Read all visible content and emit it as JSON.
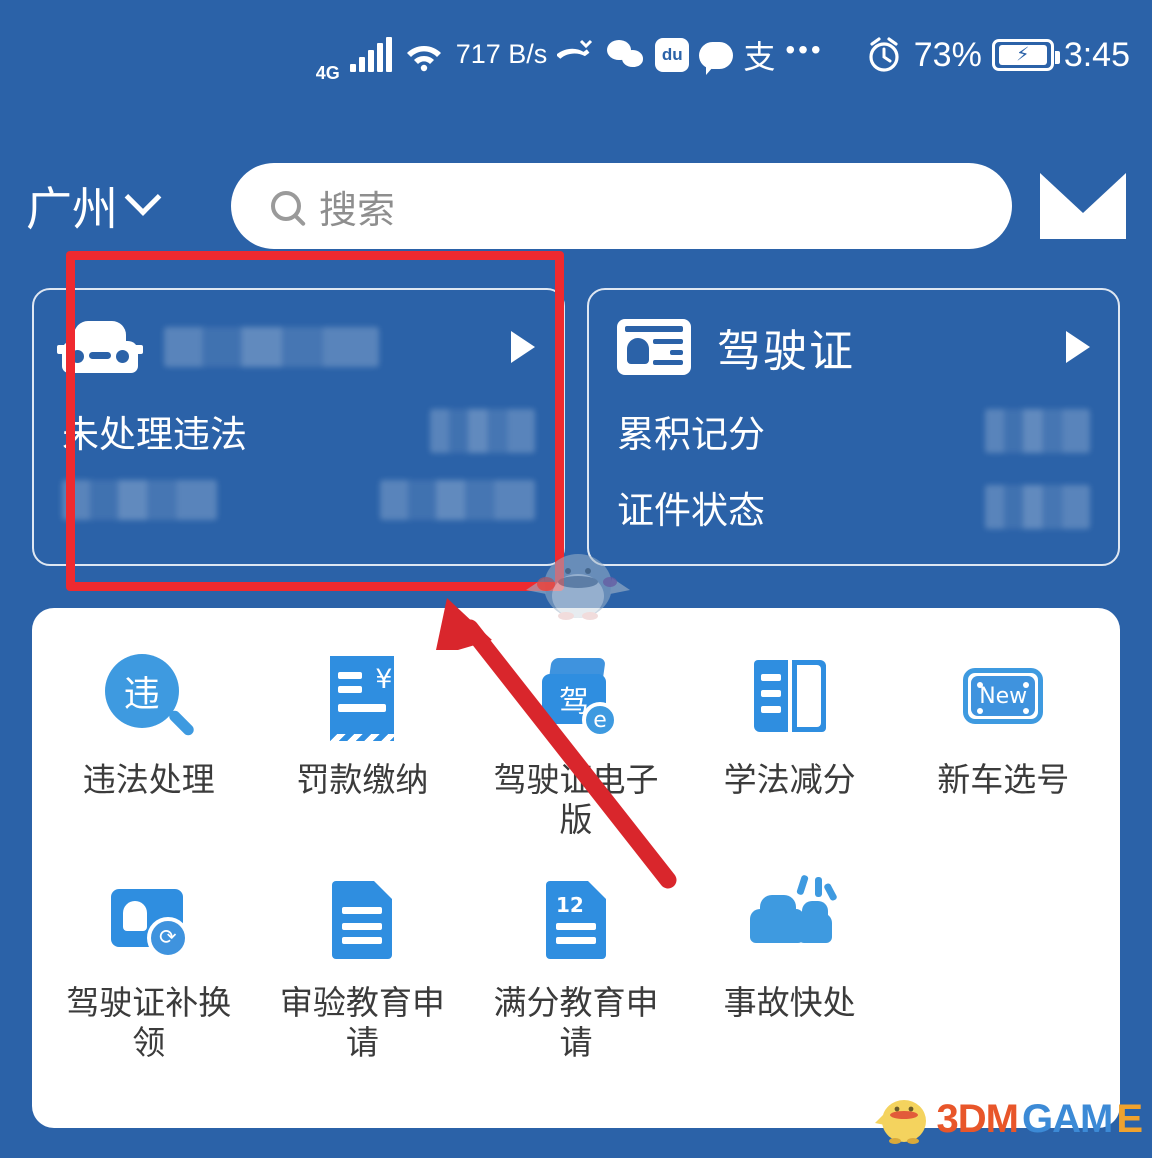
{
  "status_bar": {
    "network_type": "4G",
    "data_speed": "717 B/s",
    "battery_percent": "73%",
    "time": "3:45",
    "icons": [
      "signal-bars-icon",
      "wifi-icon",
      "missed-call-icon",
      "wechat-icon",
      "baidu-icon",
      "message-icon",
      "alipay-icon",
      "more-dots-icon",
      "alarm-icon",
      "battery-charging-icon"
    ],
    "overflow_dots": "•••",
    "baidu_glyph": "du",
    "alipay_glyph": "支",
    "missed_call_glyph": "↘"
  },
  "header": {
    "city": "广州",
    "city_chevron": "chevron-down-icon",
    "search_placeholder": "搜索",
    "search_value": "",
    "mail_icon": "mail-icon"
  },
  "cards": [
    {
      "icon": "car-icon",
      "title": "",
      "title_redacted": true,
      "arrow": "▶",
      "rows": [
        {
          "label": "未处理违法",
          "value": "",
          "redacted": true
        },
        {
          "label": "",
          "label_redacted": true,
          "value": "",
          "redacted": true
        }
      ]
    },
    {
      "icon": "id-card-icon",
      "title": "驾驶证",
      "title_redacted": false,
      "arrow": "▶",
      "rows": [
        {
          "label": "累积记分",
          "value": "",
          "redacted": true
        },
        {
          "label": "证件状态",
          "value": "",
          "redacted": true
        }
      ]
    }
  ],
  "grid": {
    "items": [
      {
        "label": "违法处理",
        "icon": "violation-search-icon",
        "glyph": "违"
      },
      {
        "label": "罚款缴纳",
        "icon": "fine-receipt-icon",
        "glyph": "¥"
      },
      {
        "label": "驾驶证电子版",
        "icon": "digital-license-icon",
        "glyph": "驾",
        "badge": "e"
      },
      {
        "label": "学法减分",
        "icon": "study-book-icon",
        "glyph": ""
      },
      {
        "label": "新车选号",
        "icon": "new-plate-icon",
        "glyph": "New"
      },
      {
        "label": "驾驶证补换领",
        "icon": "license-renew-icon",
        "glyph": "⟳"
      },
      {
        "label": "审验教育申请",
        "icon": "document-icon",
        "glyph": ""
      },
      {
        "label": "满分教育申请",
        "icon": "document-12-icon",
        "glyph": "12"
      },
      {
        "label": "事故快处",
        "icon": "accident-cars-icon",
        "glyph": ""
      }
    ]
  },
  "annotations": {
    "highlight_box": "red-rectangle-highlight",
    "pointer": "red-arrow"
  },
  "watermark": {
    "mascot": "bird-mascot-icon",
    "brand_part1": "3DM",
    "brand_part2": "GAM",
    "brand_part3": "E"
  },
  "colors": {
    "background_blue": "#2b62a8",
    "panel_white": "#ffffff",
    "icon_blue": "#2f8ee0",
    "annotation_red": "#ef2a2f"
  }
}
